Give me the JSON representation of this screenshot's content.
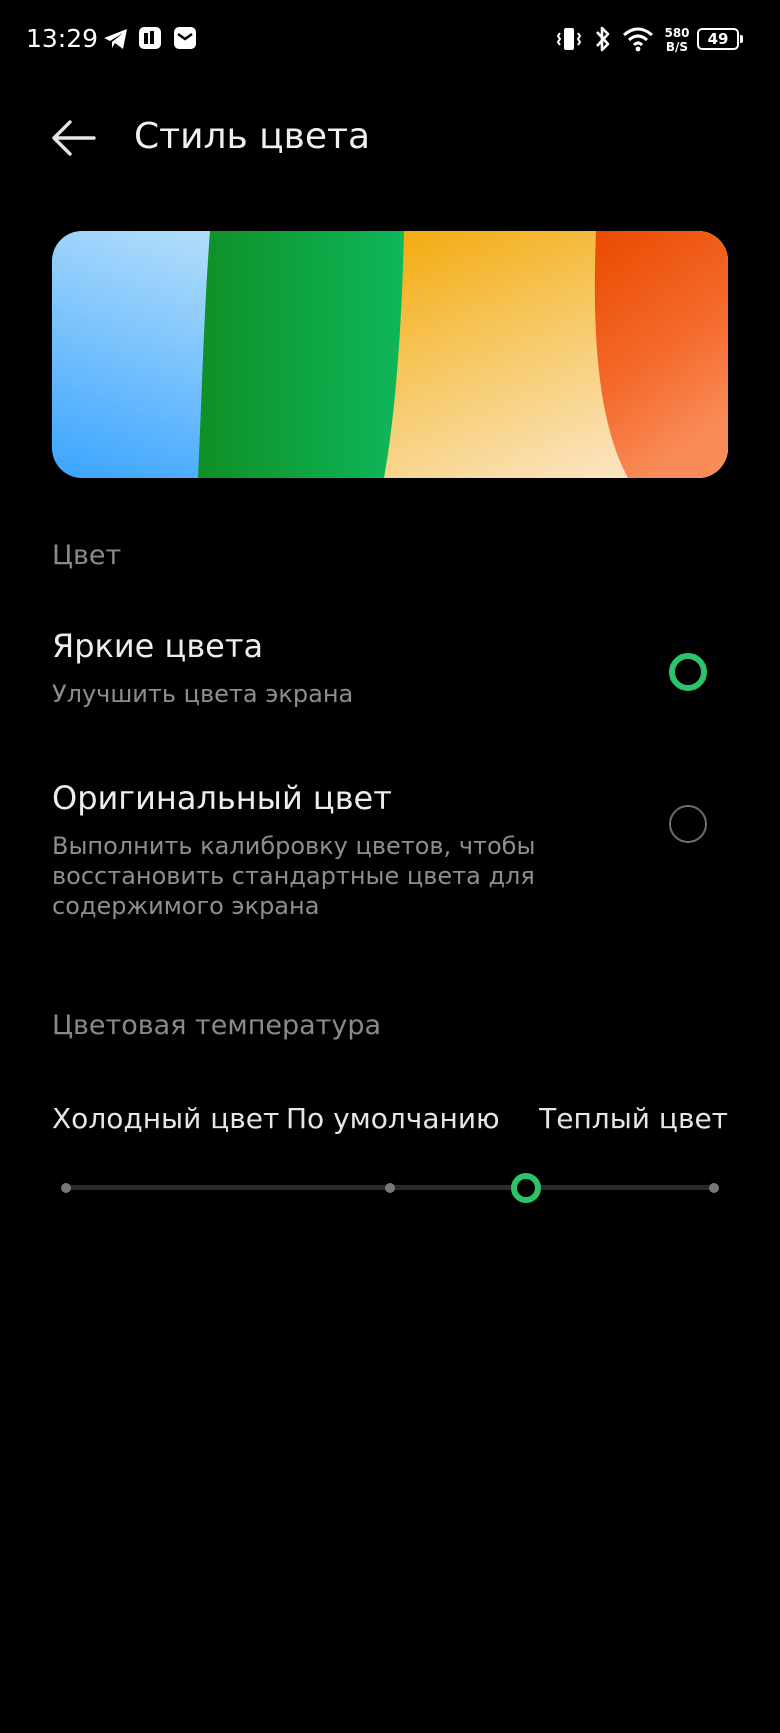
{
  "status_bar": {
    "time": "13:29",
    "net_speed_value": "580",
    "net_speed_unit": "B/S",
    "battery": "49",
    "icons": [
      "telegram-icon",
      "app-icon",
      "mail-icon",
      "vibrate-icon",
      "bluetooth-icon",
      "wifi-icon"
    ]
  },
  "header": {
    "title": "Стиль цвета"
  },
  "color_section": {
    "label": "Цвет",
    "options": [
      {
        "title": "Яркие цвета",
        "subtitle": "Улучшить цвета экрана",
        "selected": true
      },
      {
        "title": "Оригинальный цвет",
        "subtitle": "Выполнить калибровку цветов, чтобы восстановить стандартные цвета для содержимого экрана",
        "selected": false
      }
    ]
  },
  "temperature_section": {
    "label": "Цветовая температура",
    "labels": [
      "Холодный цвет",
      "По умолчанию",
      "Теплый цвет"
    ],
    "slider": {
      "min": 0,
      "max": 1,
      "value": 0.71,
      "ticks": [
        0,
        0.5,
        1
      ]
    }
  },
  "colors": {
    "accent": "#2dc36a",
    "background": "#000000"
  }
}
